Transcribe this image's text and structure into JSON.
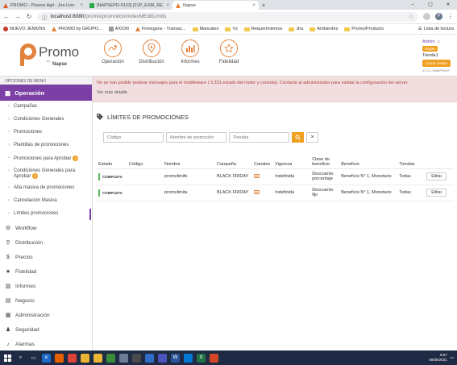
{
  "browser": {
    "tabs": [
      {
        "title": "PROMO - Pizarra Ágil - Jira Linx",
        "active": false
      },
      {
        "title": "[NAPSEPD-9133] [21P_EXM_RE...",
        "active": false
      },
      {
        "title": "Napse",
        "active": true
      }
    ],
    "url_host": "localhost:8080",
    "url_path": "/promo/promotion/indexMEditLimits",
    "profile_initial": "P",
    "bookmarks": [
      {
        "label": "NUEVO JENKINS",
        "type": "site"
      },
      {
        "label": "PROMO by GRUPO...",
        "type": "site"
      },
      {
        "label": "AXION",
        "type": "site"
      },
      {
        "label": "Finnegans - Transac...",
        "type": "site"
      },
      {
        "label": "Manuales",
        "type": "folder"
      },
      {
        "label": "Vs",
        "type": "folder"
      },
      {
        "label": "Requerimientos",
        "type": "folder"
      },
      {
        "label": "Jira",
        "type": "folder"
      },
      {
        "label": "Ambientes",
        "type": "folder"
      },
      {
        "label": "Promo/Producto",
        "type": "folder"
      }
    ],
    "reading_list": "Lista de lectura"
  },
  "header": {
    "logo_text": "Promo",
    "logo_by": "by",
    "logo_brand": "Napse",
    "modules": [
      {
        "label": "Operación",
        "icon": "operation-icon"
      },
      {
        "label": "Distribución",
        "icon": "location-pin-icon"
      },
      {
        "label": "Informes",
        "icon": "bar-chart-icon"
      },
      {
        "label": "Fidelidad",
        "icon": "star-icon"
      }
    ],
    "user": {
      "name": "Admin",
      "company_badge": "Napse",
      "store": "Tienda1",
      "logout_label": "Cerrar sesión",
      "version": "v7.3.1-SNAPSHOT"
    }
  },
  "sidebar": {
    "heading": "OPCIONES DE MENÚ",
    "active_section": "Operación",
    "sub_items": [
      {
        "label": "Campañas"
      },
      {
        "label": "Condiciones Generales"
      },
      {
        "label": "Promociones"
      },
      {
        "label": "Plantillas de promociones"
      },
      {
        "label": "Promociones para Aprobar",
        "badge": "2"
      },
      {
        "label": "Condiciones Generales para Aprobar",
        "badge": "0"
      },
      {
        "label": "Alta masiva de promociones"
      },
      {
        "label": "Cancelación Masiva"
      },
      {
        "label": "Límites promociones",
        "current": true
      }
    ],
    "main_items": [
      {
        "label": "Workflow",
        "icon": "gear-icon",
        "glyph": "⚙"
      },
      {
        "label": "Distribución",
        "icon": "location-pin-icon",
        "glyph": "⚲"
      },
      {
        "label": "Precios",
        "icon": "dollar-icon",
        "glyph": "$"
      },
      {
        "label": "Fidelidad",
        "icon": "star-icon",
        "glyph": "★"
      },
      {
        "label": "Informes",
        "icon": "bar-chart-icon",
        "glyph": "▥"
      },
      {
        "label": "Negocio",
        "icon": "briefcase-icon",
        "glyph": "▤"
      },
      {
        "label": "Administración",
        "icon": "building-icon",
        "glyph": "▦"
      },
      {
        "label": "Seguridad",
        "icon": "users-icon",
        "glyph": "♟"
      },
      {
        "label": "Alarmas",
        "icon": "bell-icon",
        "glyph": "♪"
      }
    ]
  },
  "alert": {
    "message": "No se han podido postear mensajes para el middleware ( 9.331 estado del motor y consola). Contacte al administrador para validar la configuración del server.",
    "detail_link": "Ver más detalle"
  },
  "page": {
    "title": "LÍMITES DE PROMOCIONES",
    "filters": {
      "code_placeholder": "Código",
      "name_placeholder": "Nombre de promoción",
      "stores_placeholder": "Tiendas"
    }
  },
  "table": {
    "headers": [
      "Estado",
      "Código",
      "Nombre",
      "Campaña",
      "Canales",
      "Vigencia",
      "Clase de beneficio",
      "Beneficio",
      "Tiendas",
      ""
    ],
    "rows": [
      {
        "estado": "COMPLETA",
        "codigo": "",
        "nombre": "promolimitb",
        "campana": "BLACK FRIDAY",
        "vigencia": "Indefinida",
        "clase": "Descuento porcentaje",
        "beneficio": "Beneficio N° 1, Monetario",
        "tiendas": "Todas",
        "action": "Editar"
      },
      {
        "estado": "COMPLETA",
        "codigo": "",
        "nombre": "promolimita",
        "campana": "BLACK FRIDAY",
        "vigencia": "Indefinida",
        "clase": "Descuento fijo",
        "beneficio": "Beneficio N° 1, Monetario",
        "tiendas": "Todas",
        "action": "Editar"
      }
    ]
  },
  "taskbar": {
    "time": "9:57",
    "date": "08/06/2021"
  },
  "colors": {
    "brand_purple": "#7b3fa6",
    "accent_orange": "#f0a020",
    "alert_bg": "#f2dede",
    "status_green": "#5cb85c"
  }
}
